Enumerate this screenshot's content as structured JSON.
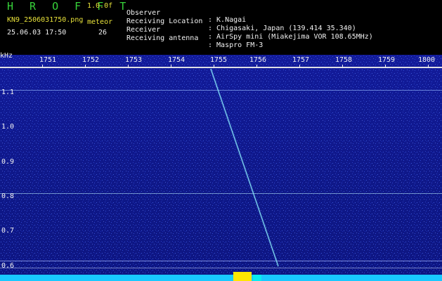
{
  "header": {
    "logo": "H R O F F T",
    "version": "1.0.0f",
    "filename": "KN9_2506031750.png",
    "mode": "meteor",
    "datetime": "25.06.03 17:50",
    "count": "26",
    "meta": [
      {
        "key": "Observer",
        "value": ": K.Nagai"
      },
      {
        "key": "Receiving Location",
        "value": ": Chigasaki, Japan (139.414 35.340)"
      },
      {
        "key": "Receiver",
        "value": ": AirSpy mini (Miakejima VOR 108.65MHz)"
      },
      {
        "key": "Receiving antenna",
        "value": ": Maspro FM-3"
      }
    ]
  },
  "axis": {
    "y_unit": "kHz",
    "x_ticks": [
      "1751",
      "1752",
      "1753",
      "1754",
      "1755",
      "1756",
      "1757",
      "1758",
      "1759",
      "1800"
    ],
    "y_ticks": [
      "1.1",
      "1.0",
      "0.9",
      "0.8",
      "0.7",
      "0.6"
    ]
  }
}
